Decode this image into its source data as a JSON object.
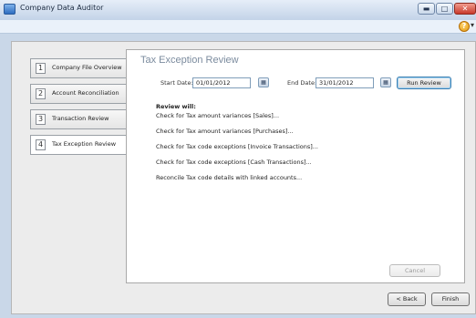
{
  "window": {
    "title": "Company Data Auditor"
  },
  "title_buttons": {
    "minimize": "▬",
    "maximize": "□",
    "close": "✕"
  },
  "steps": [
    {
      "number": "1",
      "label": "Company File Overview"
    },
    {
      "number": "2",
      "label": "Account Reconciliation"
    },
    {
      "number": "3",
      "label": "Transaction Review"
    },
    {
      "number": "4",
      "label": "Tax Exception Review"
    }
  ],
  "panel": {
    "title": "Tax Exception Review",
    "start_date_label": "Start Date:",
    "start_date_value": "01/01/2012",
    "end_date_label": "End Date:",
    "end_date_value": "31/01/2012",
    "run_button": "Run Review",
    "review_heading": "Review will:",
    "review_items": [
      "Check for Tax amount variances [Sales]...",
      "Check for Tax amount variances [Purchases]...",
      "Check for Tax code exceptions [Invoice Transactions]...",
      "Check for Tax code exceptions [Cash Transactions]...",
      "Reconcile Tax code details with linked accounts..."
    ],
    "cancel_button": "Cancel"
  },
  "footer": {
    "back_button": "< Back",
    "finish_button": "Finish"
  },
  "colors": {
    "accent": "#7b8b9e",
    "window_frame": "#c9d7e8"
  }
}
